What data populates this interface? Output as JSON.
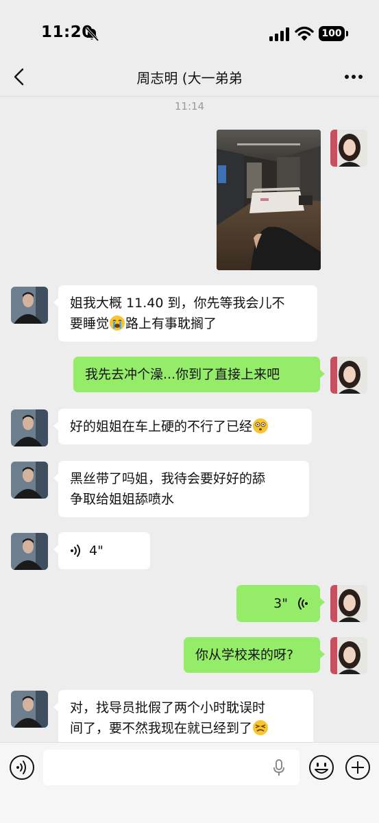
{
  "status_bar": {
    "time": "11:20",
    "battery": "100"
  },
  "header": {
    "title": "周志明 (大一弟弟"
  },
  "chat": {
    "timestamp": "11:14",
    "messages": [
      {
        "side": "right",
        "type": "image"
      },
      {
        "side": "left",
        "type": "text",
        "line1": "姐我大概 11.40 到，你先等我会儿不",
        "line2": "要睡觉",
        "line2_after": "路上有事耽搁了",
        "emoji": "crying-face-emoji"
      },
      {
        "side": "right",
        "type": "text",
        "text": "我先去冲个澡...你到了直接上来吧"
      },
      {
        "side": "left",
        "type": "text",
        "text": "好的姐姐在车上硬的不行了已经",
        "emoji": "dizzy-face-emoji"
      },
      {
        "side": "left",
        "type": "text",
        "line1": "黑丝带了吗姐，我待会要好好的舔",
        "line2": "争取给姐姐舔喷水"
      },
      {
        "side": "left",
        "type": "voice",
        "duration": "4\""
      },
      {
        "side": "right",
        "type": "voice",
        "duration": "3\""
      },
      {
        "side": "right",
        "type": "text",
        "text": "你从学校来的呀?"
      },
      {
        "side": "left",
        "type": "text",
        "line1": "对，找导员批假了两个小时耽误时",
        "line2": "间了，要不然我现在就已经到了",
        "emoji": "persevering-face-emoji"
      }
    ]
  },
  "input": {
    "placeholder": ""
  },
  "colors": {
    "background": "#ededed",
    "outgoing_bubble": "#95ec69",
    "incoming_bubble": "#ffffff"
  }
}
